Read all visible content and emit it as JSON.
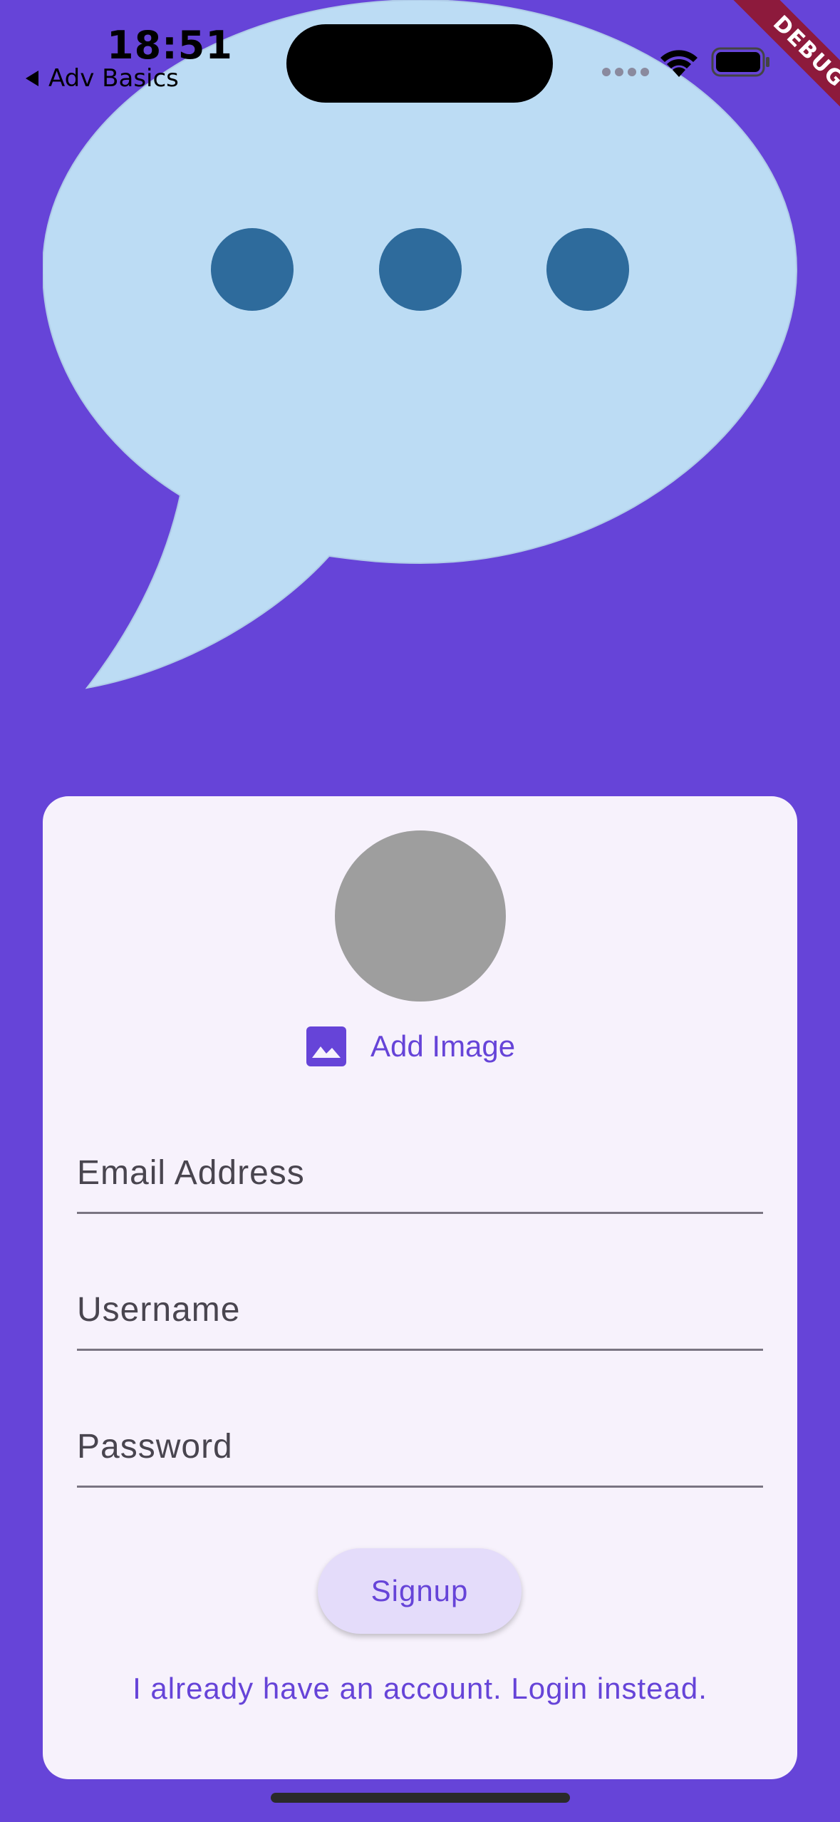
{
  "status_bar": {
    "time": "18:51",
    "back_label": "Adv Basics"
  },
  "debug_banner": "DEBUG",
  "colors": {
    "background": "#6644d8",
    "card": "#f7f2fc",
    "bubble": "#bcdcf4",
    "bubble_dots": "#2e6b9c",
    "accent": "#6644d8",
    "avatar": "#9e9e9e",
    "button_bg": "#e4dcfa"
  },
  "auth_form": {
    "add_image_label": "Add Image",
    "email_placeholder": "Email Address",
    "username_placeholder": "Username",
    "password_placeholder": "Password",
    "signup_label": "Signup",
    "login_switch_label": "I already have an account. Login instead."
  }
}
